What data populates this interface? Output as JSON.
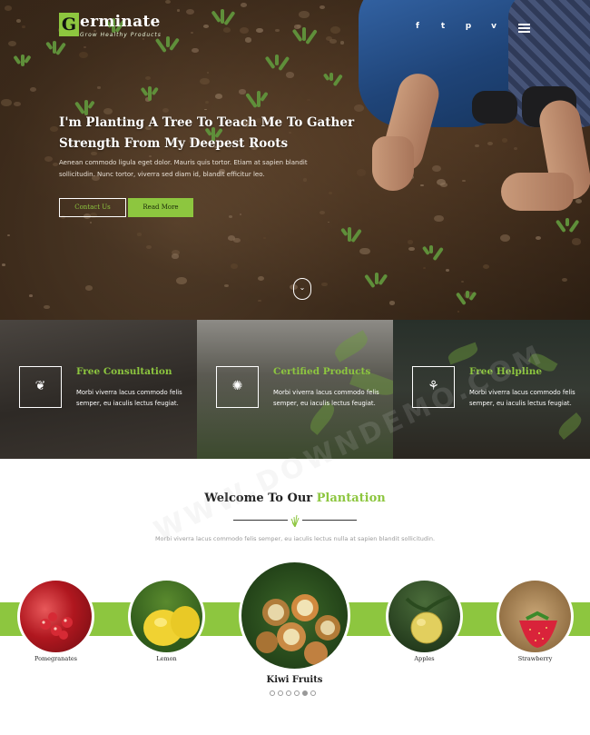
{
  "brand": {
    "initial": "G",
    "name": "erminate",
    "tagline": "Grow Healthy Products",
    "accent_color": "#8dc63f"
  },
  "header": {
    "social_icons": [
      "facebook-icon",
      "twitter-icon",
      "pinterest-icon",
      "vimeo-icon"
    ],
    "social_glyphs": [
      "f",
      "t",
      "p",
      "v"
    ],
    "menu_icon": "hamburger-menu-icon"
  },
  "hero": {
    "title_line1": "I'm Planting A Tree To Teach Me To Gather",
    "title_line2": "Strength From My Deepest Roots",
    "text": "Aenean commodo ligula eget dolor. Mauris quis tortor. Etiam at sapien blandit sollicitudin. Nunc tortor, viverra sed diam id, blandit efficitur leo.",
    "button_primary": "Contact Us",
    "button_secondary": "Read More",
    "scroll_glyph": "⌄"
  },
  "features": [
    {
      "title": "Free Consultation",
      "text": "Morbi viverra lacus commodo felis semper, eu iaculis lectus feugiat.",
      "icon": "plant-icon",
      "glyph": "❦"
    },
    {
      "title": "Certified Products",
      "text": "Morbi viverra lacus commodo felis semper, eu iaculis lectus feugiat.",
      "icon": "badge-icon",
      "glyph": "✺"
    },
    {
      "title": "Free Helpline",
      "text": "Morbi viverra lacus commodo felis semper, eu iaculis lectus feugiat.",
      "icon": "sprout-icon",
      "glyph": "⚘"
    }
  ],
  "welcome": {
    "title_prefix": "Welcome To Our ",
    "title_accent": "Plantation",
    "subtitle": "Morbi viverra lacus commodo felis semper, eu iaculis lectus nulla at sapien blandit sollicitudin."
  },
  "fruits": [
    {
      "label": "Pomegranates"
    },
    {
      "label": "Lemon"
    },
    {
      "label": "Kiwi Fruits"
    },
    {
      "label": "Apples"
    },
    {
      "label": "Strawberry"
    }
  ],
  "carousel": {
    "total": 6,
    "active_index": 4
  },
  "watermark": "WWW.DOWNDEMO.COM"
}
